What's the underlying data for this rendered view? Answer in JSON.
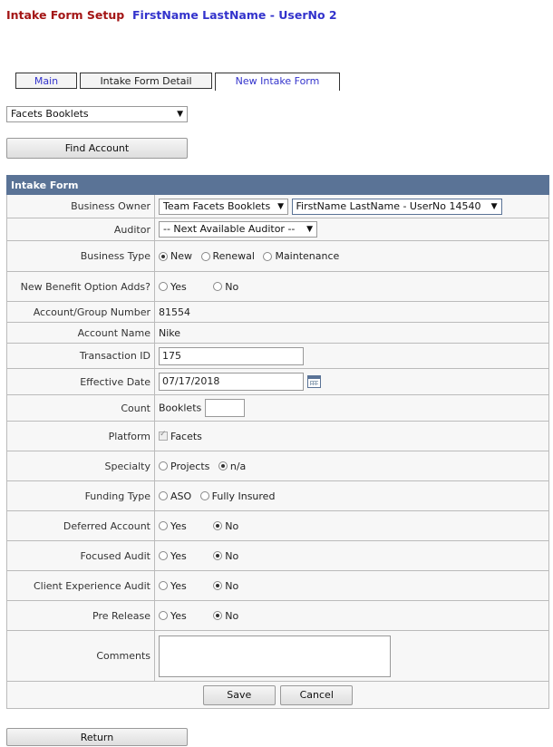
{
  "header": {
    "title": "Intake Form Setup",
    "user": "FirstName LastName - UserNo 2"
  },
  "tabs": {
    "main": "Main",
    "detail": "Intake Form Detail",
    "new_form": "New Intake Form"
  },
  "product_select": "Facets Booklets",
  "find_account_label": "Find Account",
  "form": {
    "section_title": "Intake Form",
    "business_owner": {
      "label": "Business Owner",
      "team": "Team Facets Booklets",
      "person": "FirstName LastName - UserNo 14540"
    },
    "auditor": {
      "label": "Auditor",
      "value": "-- Next Available Auditor --"
    },
    "business_type": {
      "label": "Business Type",
      "options": [
        "New",
        "Renewal",
        "Maintenance"
      ],
      "selected": "New"
    },
    "new_benefit": {
      "label": "New Benefit Option Adds?",
      "options": [
        "Yes",
        "No"
      ]
    },
    "account_group": {
      "label": "Account/Group Number",
      "value": "81554"
    },
    "account_name": {
      "label": "Account Name",
      "value": "Nike"
    },
    "transaction_id": {
      "label": "Transaction ID",
      "value": "175"
    },
    "effective_date": {
      "label": "Effective Date",
      "value": "07/17/2018"
    },
    "count": {
      "label": "Count",
      "unit": "Booklets",
      "value": ""
    },
    "platform": {
      "label": "Platform",
      "option": "Facets",
      "checked": true
    },
    "specialty": {
      "label": "Specialty",
      "options": [
        "Projects",
        "n/a"
      ],
      "selected": "n/a"
    },
    "funding_type": {
      "label": "Funding Type",
      "options": [
        "ASO",
        "Fully Insured"
      ]
    },
    "deferred_account": {
      "label": "Deferred Account",
      "options": [
        "Yes",
        "No"
      ],
      "selected": "No"
    },
    "focused_audit": {
      "label": "Focused Audit",
      "options": [
        "Yes",
        "No"
      ],
      "selected": "No"
    },
    "client_experience": {
      "label": "Client Experience Audit",
      "options": [
        "Yes",
        "No"
      ],
      "selected": "No"
    },
    "pre_release": {
      "label": "Pre Release",
      "options": [
        "Yes",
        "No"
      ],
      "selected": "No"
    },
    "comments": {
      "label": "Comments",
      "value": ""
    },
    "save_label": "Save",
    "cancel_label": "Cancel"
  },
  "return_label": "Return",
  "colors": {
    "title": "#a31515",
    "user": "#3333cc",
    "section_header": "#5a7396"
  }
}
